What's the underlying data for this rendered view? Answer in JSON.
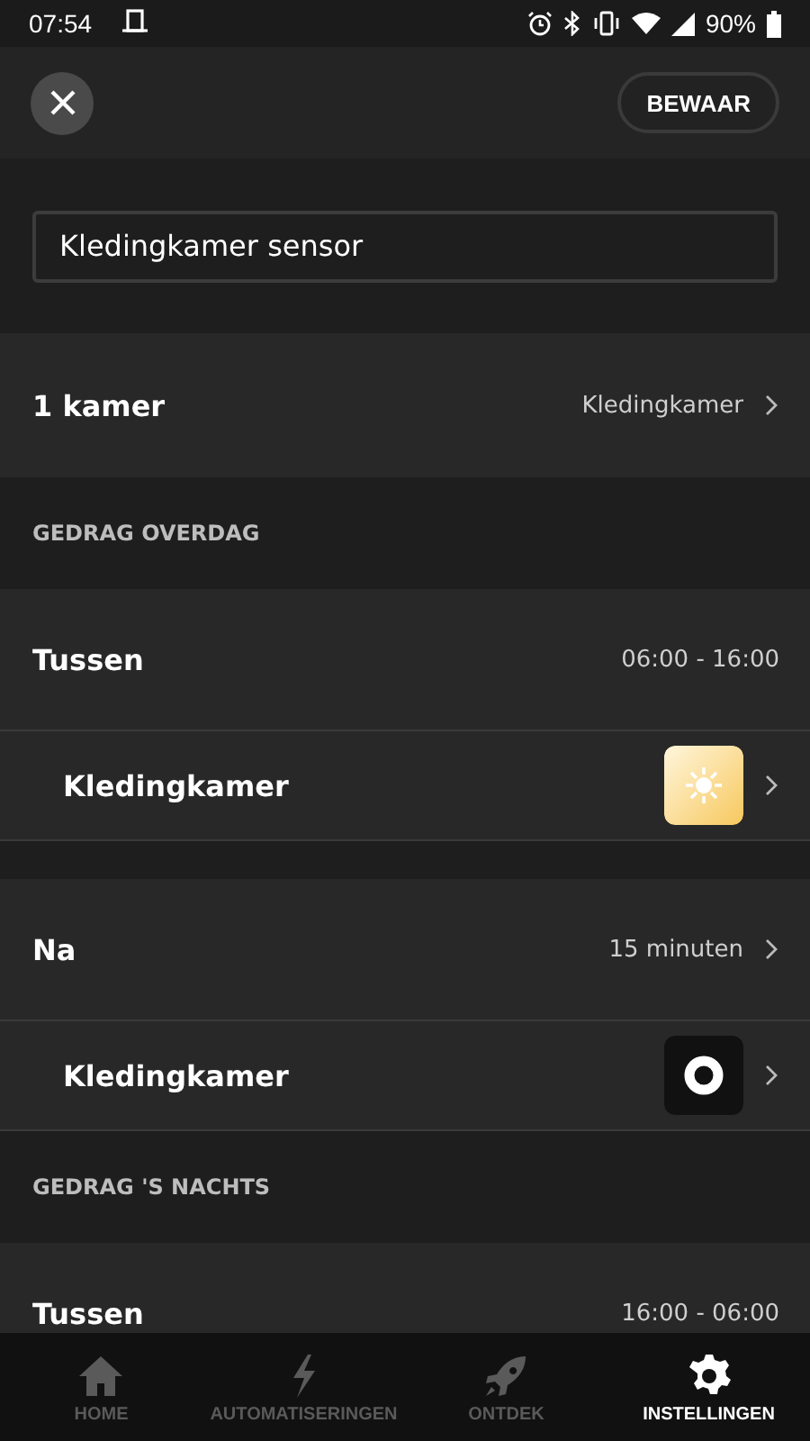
{
  "status_bar": {
    "time": "07:54",
    "battery": "90%"
  },
  "header": {
    "save_button": "BEWAAR"
  },
  "name_field": {
    "value": "Kledingkamer sensor"
  },
  "room_row": {
    "label": "1 kamer",
    "value": "Kledingkamer"
  },
  "sections": [
    {
      "title": "GEDRAG OVERDAG",
      "groups": [
        [
          {
            "kind": "value",
            "label": "Tussen",
            "value": "06:00 - 16:00",
            "chevron": false
          },
          {
            "kind": "bright",
            "label": "Kledingkamer"
          }
        ],
        [
          {
            "kind": "value",
            "label": "Na",
            "value": "15 minuten",
            "chevron": true
          },
          {
            "kind": "dark",
            "label": "Kledingkamer"
          }
        ]
      ]
    },
    {
      "title": "GEDRAG 'S NACHTS",
      "groups": [
        [
          {
            "kind": "value",
            "label": "Tussen",
            "value": "16:00 - 06:00",
            "chevron": false
          }
        ]
      ]
    }
  ],
  "tabs": [
    {
      "label": "HOME",
      "selected": false
    },
    {
      "label": "AUTOMATISERINGEN",
      "selected": false
    },
    {
      "label": "ONTDEK",
      "selected": false
    },
    {
      "label": "INSTELLINGEN",
      "selected": true
    }
  ]
}
